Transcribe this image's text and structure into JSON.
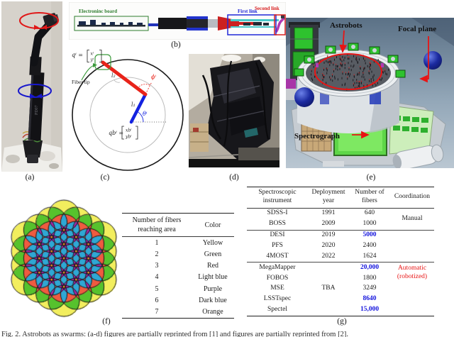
{
  "figure": {
    "caption": "Fig. 2. Astrobots as swarms: (a-d) figures are partially reprinted from [1] and figures are partially reprinted from [2].",
    "panel_labels": {
      "a": "(a)",
      "b": "(b)",
      "c": "(c)",
      "d": "(d)",
      "e": "(e)",
      "f": "(f)",
      "g": "(g)"
    }
  },
  "panel_a": {
    "arm_marking": "PD07",
    "axis1_color": "#e01818",
    "axis2_color": "#1818cc"
  },
  "panel_b": {
    "electronic_board_label": "Electroninc board",
    "first_link_label": "First link",
    "second_link_label": "Second link",
    "electronic_board_color": "#2e7d2e",
    "first_link_color": "#2028d8",
    "second_link_color": "#d82020"
  },
  "panel_c": {
    "fiber_tip_label": "Fiber tip",
    "q_label": "qⁱ =",
    "q_x": "xⁱ",
    "q_y": "yⁱ",
    "qb_label": "qbⁱ =",
    "qb_x": "xbⁱ",
    "qb_y": "ybⁱ",
    "l1_label": "l₁",
    "l2_label": "l₂",
    "phi_label": "ϕⁱ",
    "theta_label": "θⁱ",
    "first_link_color": "#1322e0",
    "second_link_color": "#e8231a"
  },
  "panel_e": {
    "astrobots_label": "Astrobots",
    "focal_plane_label": "Focal plane",
    "spectrograph_label": "Spectrograph",
    "arrow_color": "#e81414"
  },
  "fiber_pattern": {
    "type": "overlap-map",
    "hex_rings": 3,
    "spacing": 20,
    "circle_radius": 22,
    "outline_color": "#141414",
    "overlap_colors": {
      "1": "#f2ee5e",
      "2": "#56c22d",
      "3": "#ef5b40",
      "4": "#2fa7d4",
      "5": "#a426a4",
      "6": "#2b2fd4",
      "7": "#ef9426"
    }
  },
  "color_table": {
    "headers": [
      "Number of fibers reaching area",
      "Color"
    ],
    "rows": [
      [
        "1",
        "Yellow"
      ],
      [
        "2",
        "Green"
      ],
      [
        "3",
        "Red"
      ],
      [
        "4",
        "Light blue"
      ],
      [
        "5",
        "Purple"
      ],
      [
        "6",
        "Dark blue"
      ],
      [
        "7",
        "Orange"
      ]
    ]
  },
  "instrument_table": {
    "headers": [
      "Spectroscopic instrument",
      "Deployment year",
      "Number of fibers",
      "Coordination"
    ],
    "highlight_color": "#1414dd",
    "automatic_color": "#e81414",
    "groups": [
      {
        "rows": [
          {
            "instrument": "SDSS-I",
            "year": "1991",
            "fibers": "640",
            "highlight": false
          },
          {
            "instrument": "BOSS",
            "year": "2009",
            "fibers": "1000",
            "highlight": false
          }
        ],
        "year_merged": null,
        "coordination": "Manual",
        "coordination_style": "normal"
      },
      {
        "rows": [
          {
            "instrument": "DESI",
            "year": "2019",
            "fibers": "5000",
            "highlight": true
          },
          {
            "instrument": "PFS",
            "year": "2020",
            "fibers": "2400",
            "highlight": false
          },
          {
            "instrument": "4MOST",
            "year": "2022",
            "fibers": "1624",
            "highlight": false
          }
        ],
        "year_merged": null,
        "coordination": "",
        "coordination_style": "normal"
      },
      {
        "rows": [
          {
            "instrument": "MegaMapper",
            "year": "",
            "fibers": "20,000",
            "highlight": true
          },
          {
            "instrument": "FOBOS",
            "year": "",
            "fibers": "1800",
            "highlight": false
          },
          {
            "instrument": "MSE",
            "year": "",
            "fibers": "3249",
            "highlight": false
          },
          {
            "instrument": "LSSTspec",
            "year": "",
            "fibers": "8640",
            "highlight": true
          },
          {
            "instrument": "Spectel",
            "year": "",
            "fibers": "15,000",
            "highlight": true
          }
        ],
        "year_merged": "TBA",
        "coordination": "Automatic (robotized)",
        "coordination_style": "automatic"
      }
    ]
  }
}
